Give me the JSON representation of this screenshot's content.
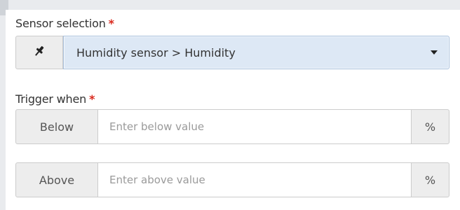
{
  "sensor": {
    "label": "Sensor selection",
    "required_mark": "*",
    "icon": "plug-icon",
    "selected_value": "Humidity sensor > Humidity"
  },
  "trigger": {
    "label": "Trigger when",
    "required_mark": "*",
    "below": {
      "label": "Below",
      "placeholder": "Enter below value",
      "unit": "%"
    },
    "above": {
      "label": "Above",
      "placeholder": "Enter above value",
      "unit": "%"
    }
  },
  "colors": {
    "required": "#d9281c",
    "select_bg": "#dde8f5",
    "addon_bg": "#ededed"
  }
}
